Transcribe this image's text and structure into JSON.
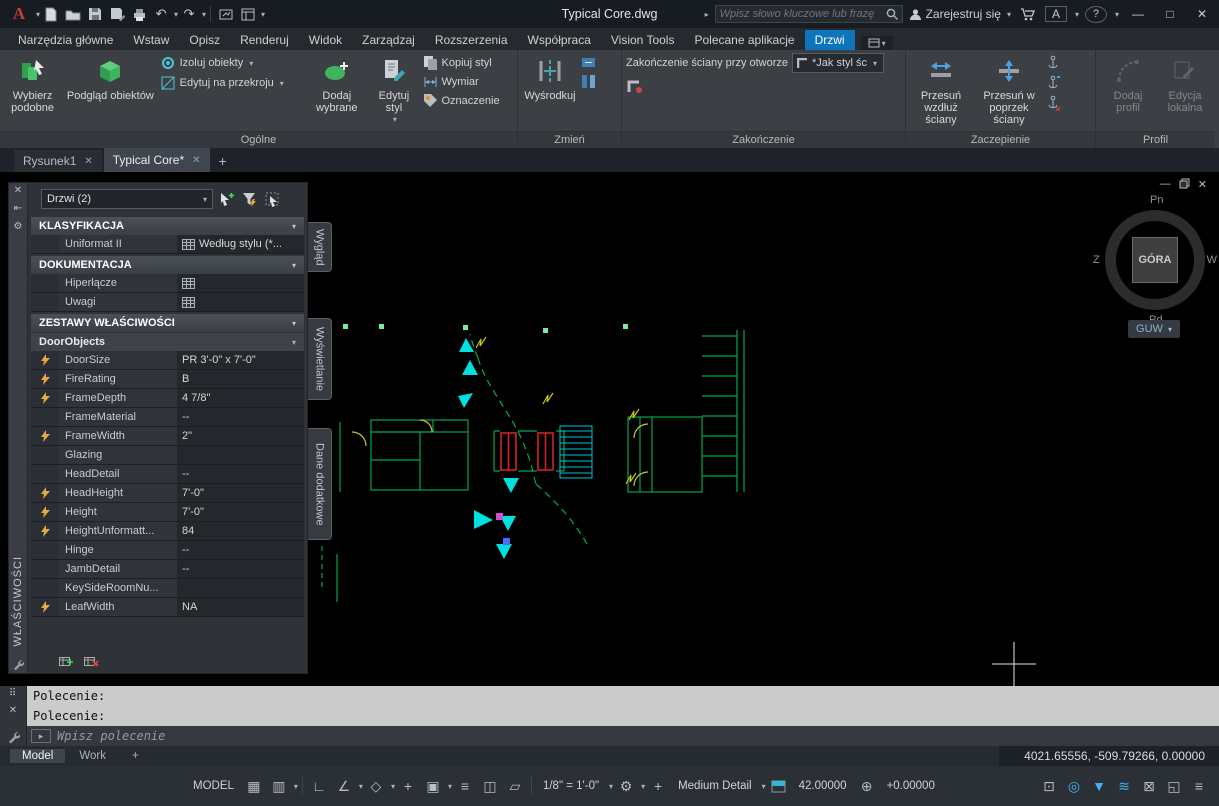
{
  "icons": {
    "dropdown": "▾",
    "expand": "▸",
    "close": "✕",
    "minimize": "—",
    "maximize": "□",
    "undo": "↶",
    "redo": "↷",
    "help": "?",
    "plus": "+",
    "hamburger": "≡"
  },
  "titlebar": {
    "title": "Typical Core.dwg",
    "search_placeholder": "Wpisz słowo kluczowe lub frazę",
    "sign_in": "Zarejestruj się"
  },
  "ribbon_tabs": [
    {
      "label": "Narzędzia główne"
    },
    {
      "label": "Wstaw"
    },
    {
      "label": "Opisz"
    },
    {
      "label": "Renderuj"
    },
    {
      "label": "Widok"
    },
    {
      "label": "Zarządzaj"
    },
    {
      "label": "Rozszerzenia"
    },
    {
      "label": "Współpraca"
    },
    {
      "label": "Vision Tools"
    },
    {
      "label": "Polecane aplikacje"
    },
    {
      "label": "Drzwi"
    }
  ],
  "ribbon": {
    "select_similar": "Wybierz podobne",
    "object_viewer": "Podgląd obiektów",
    "isolate_objects": "Izoluj obiekty",
    "edit_in_section": "Edytuj na przekroju",
    "add_selected": "Dodaj wybrane",
    "edit_style": "Edytuj styl",
    "copy_style": "Kopiuj styl",
    "dimension": "Wymiar",
    "tag": "Oznaczenie",
    "center": "Wyśrodkuj",
    "endcap_label": "Zakończenie ściany przy otworze",
    "endcap_value": "*Jak styl śc",
    "reposition_along": "Przesuń wzdłuż ściany",
    "reposition_across": "Przesuń w poprzek ściany",
    "add_profile": "Dodaj profil",
    "edit_in_place": "Edycja lokalna",
    "panel_titles": [
      "Ogólne",
      "Zmień",
      "Zakończenie",
      "Zaczepienie",
      "Profil"
    ]
  },
  "file_tabs": [
    {
      "label": "Rysunek1"
    },
    {
      "label": "Typical Core*"
    }
  ],
  "palette": {
    "title": "WŁAŚCIWOŚCI",
    "selection": "Drzwi (2)",
    "classification_header": "KLASYFIKACJA",
    "uniformat_label": "Uniformat II",
    "uniformat_value": "Według stylu (*...",
    "documentation_header": "DOKUMENTACJA",
    "hyperlink_label": "Hiperłącze",
    "notes_label": "Uwagi",
    "property_sets_header": "ZESTAWY WŁAŚCIWOŚCI",
    "set_name": "DoorObjects",
    "rows": [
      {
        "label": "DoorSize",
        "value": "PR 3'-0\" x 7'-0\"",
        "auto": true
      },
      {
        "label": "FireRating",
        "value": "B",
        "auto": true
      },
      {
        "label": "FrameDepth",
        "value": "4 7/8\"",
        "auto": true
      },
      {
        "label": "FrameMaterial",
        "value": "--",
        "auto": false
      },
      {
        "label": "FrameWidth",
        "value": "2\"",
        "auto": true
      },
      {
        "label": "Glazing",
        "value": "",
        "auto": false
      },
      {
        "label": "HeadDetail",
        "value": "--",
        "auto": false
      },
      {
        "label": "HeadHeight",
        "value": "7'-0\"",
        "auto": true
      },
      {
        "label": "Height",
        "value": "7'-0\"",
        "auto": true
      },
      {
        "label": "HeightUnformatt...",
        "value": "84",
        "auto": true
      },
      {
        "label": "Hinge",
        "value": "--",
        "auto": false
      },
      {
        "label": "JambDetail",
        "value": "--",
        "auto": false
      },
      {
        "label": "KeySideRoomNu...",
        "value": "",
        "auto": false
      },
      {
        "label": "LeafWidth",
        "value": "NA",
        "auto": true
      }
    ],
    "side_tabs": [
      "Wygląd",
      "Wyświetlanie",
      "Dane dodatkowe"
    ]
  },
  "viewcube": {
    "top_face": "GÓRA",
    "north": "Pn",
    "south": "Pd",
    "east": "W",
    "west": "Z",
    "ucs": "GUW"
  },
  "command_line": {
    "history_1": "Polecenie:",
    "history_2": "Polecenie:",
    "prompt": "Wpisz polecenie"
  },
  "layout_tabs": {
    "model": "Model",
    "work": "Work"
  },
  "status_bar": {
    "coordinates": "4021.65556, -509.79266, 0.00000",
    "model_toggle": "MODEL",
    "annotation_scale": "1/8\" = 1'-0\"",
    "detail_level": "Medium Detail",
    "cut_plane": "42.00000",
    "elevation": "+0.00000",
    "icons_left": [
      {
        "name": "grid-display",
        "glyph": "▦"
      },
      {
        "name": "snap-mode",
        "glyph": "▥"
      },
      {
        "name": "ortho-mode",
        "glyph": "∟"
      },
      {
        "name": "polar-tracking",
        "glyph": "∠"
      },
      {
        "name": "isometric-drafting",
        "glyph": "◇"
      },
      {
        "name": "osnap-tracking",
        "glyph": "+"
      },
      {
        "name": "object-snap",
        "glyph": "▣"
      },
      {
        "name": "lineweight",
        "glyph": "≡"
      },
      {
        "name": "selection-cycling",
        "glyph": "◫"
      },
      {
        "name": "dynamic-input",
        "glyph": "▱"
      }
    ],
    "icons_right": [
      {
        "name": "units",
        "glyph": "⊡"
      },
      {
        "name": "graphics-performance",
        "glyph": "◎"
      },
      {
        "name": "isolate-objects",
        "glyph": "▼"
      },
      {
        "name": "hardware-acceleration",
        "glyph": "≋"
      },
      {
        "name": "lock-ui",
        "glyph": "⊠"
      },
      {
        "name": "clean-screen",
        "glyph": "◱"
      }
    ]
  },
  "colors": {
    "accent_blue": "#0d76bb",
    "wall_green": "#00a651",
    "grip_cyan": "#00e0e0",
    "door_red": "#d22222",
    "symbol_yellow": "#c9c91e",
    "auto_property_gold": "#e7a93a",
    "canvas_background": "#000000"
  }
}
